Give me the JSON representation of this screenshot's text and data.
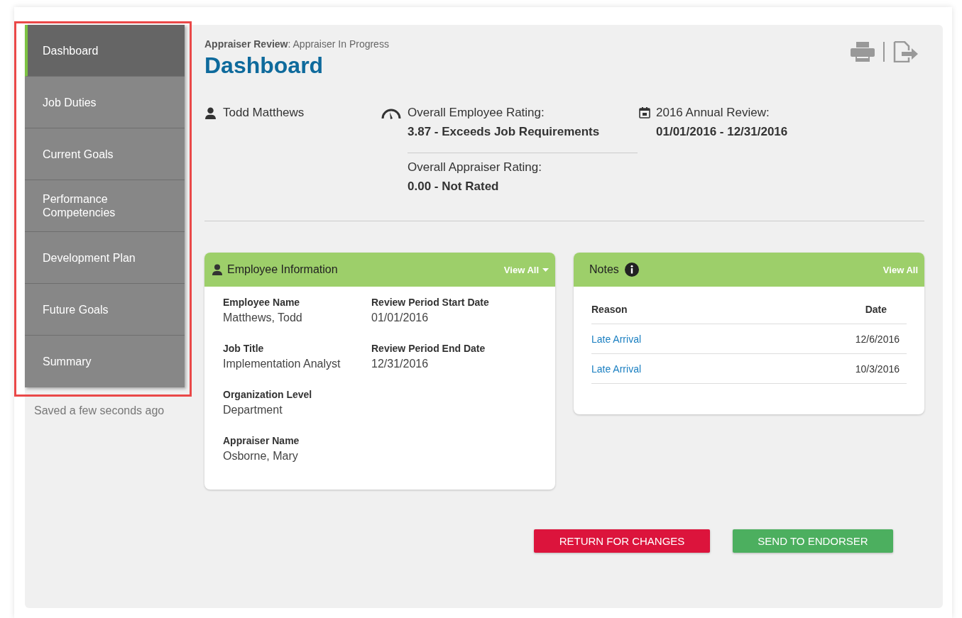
{
  "sidebar": {
    "items": [
      {
        "label": "Dashboard",
        "selected": true
      },
      {
        "label": "Job Duties",
        "selected": false
      },
      {
        "label": "Current Goals",
        "selected": false
      },
      {
        "label": "Performance Competencies",
        "selected": false
      },
      {
        "label": "Development Plan",
        "selected": false
      },
      {
        "label": "Future Goals",
        "selected": false
      },
      {
        "label": "Summary",
        "selected": false
      }
    ],
    "save_status": "Saved a few seconds ago"
  },
  "header": {
    "breadcrumb": "**Appraiser Review**: Appraiser In Progress",
    "title": "Dashboard"
  },
  "summary": {
    "employee": "Todd Matthews",
    "ratings": [
      {
        "label": "Overall Employee Rating:",
        "value": "3.87 - Exceeds Job Requirements"
      },
      {
        "label": "Overall Appraiser Rating:",
        "value": "0.00 - Not Rated"
      }
    ],
    "review": {
      "label": "2016 Annual Review:",
      "value": "01/01/2016 - 12/31/2016"
    }
  },
  "employee_information": {
    "title": "Employee Information",
    "view_all": "View All",
    "columns": [
      [
        {
          "label": "Employee Name",
          "value": "Matthews, Todd"
        },
        {
          "label": "Job Title",
          "value": "Implementation Analyst"
        },
        {
          "label": "Organization Level",
          "value": "Department"
        },
        {
          "label": "Appraiser Name",
          "value": "Osborne, Mary"
        }
      ],
      [
        {
          "label": "Review Period Start Date",
          "value": "01/01/2016"
        },
        {
          "label": "Review Period End Date",
          "value": "12/31/2016"
        }
      ]
    ]
  },
  "notes": {
    "title": "Notes",
    "view_all": "View All",
    "columns": [
      "Reason",
      "Date"
    ],
    "rows": [
      {
        "reason": "Late Arrival",
        "date": "12/6/2016"
      },
      {
        "reason": "Late Arrival",
        "date": "10/3/2016"
      }
    ]
  },
  "buttons": [
    {
      "label": "RETURN FOR CHANGES",
      "kind": "danger"
    },
    {
      "label": "SEND TO ENDORSER",
      "kind": "primary"
    }
  ]
}
